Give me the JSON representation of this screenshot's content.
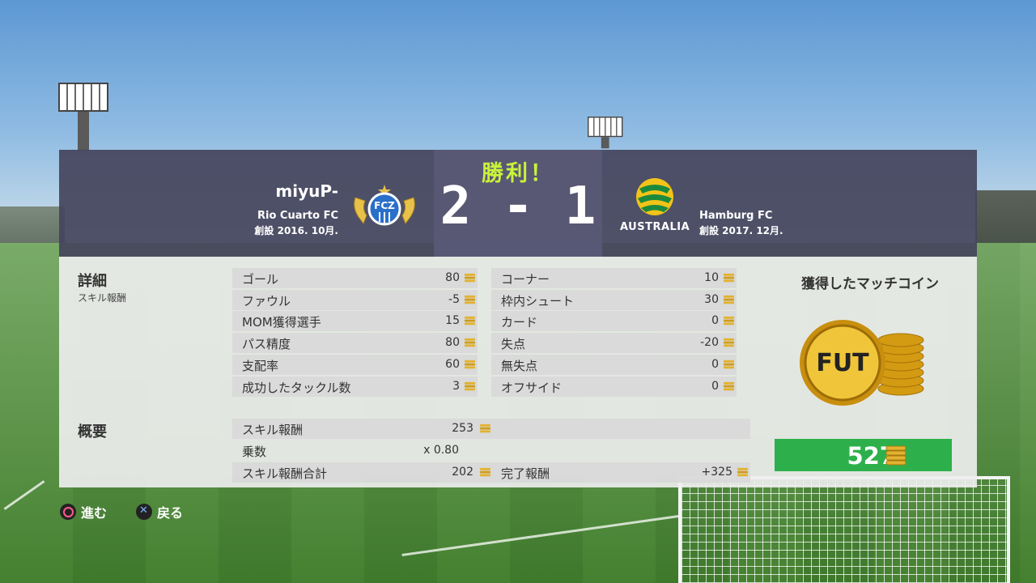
{
  "header": {
    "result": "勝利！",
    "score": "2 - 1",
    "home": {
      "player": "miyuP-",
      "club": "Rio Cuarto FC",
      "founded": "創設 2016. 10月.",
      "crest_text": "FCZ"
    },
    "away": {
      "club": "Hamburg FC",
      "founded": "創設 2017. 12月.",
      "crest_text": "AUSTRALIA"
    }
  },
  "details": {
    "title": "詳細",
    "subtitle": "スキル報酬",
    "left": [
      {
        "label": "ゴール",
        "value": "80"
      },
      {
        "label": "ファウル",
        "value": "-5"
      },
      {
        "label": "MOM獲得選手",
        "value": "15"
      },
      {
        "label": "パス精度",
        "value": "80"
      },
      {
        "label": "支配率",
        "value": "60"
      },
      {
        "label": "成功したタックル数",
        "value": "3"
      }
    ],
    "right": [
      {
        "label": "コーナー",
        "value": "10"
      },
      {
        "label": "枠内シュート",
        "value": "30"
      },
      {
        "label": "カード",
        "value": "0"
      },
      {
        "label": "失点",
        "value": "-20"
      },
      {
        "label": "無失点",
        "value": "0"
      },
      {
        "label": "オフサイド",
        "value": "0"
      }
    ]
  },
  "summary": {
    "title": "概要",
    "skill_reward": {
      "label": "スキル報酬",
      "value": "253"
    },
    "multiplier": {
      "label": "乗数",
      "value": "x 0.80"
    },
    "skill_total": {
      "label": "スキル報酬合計",
      "value": "202"
    },
    "completion": {
      "label": "完了報酬",
      "value": "+325"
    }
  },
  "coins": {
    "title": "獲得したマッチコイン",
    "logo_text": "FUT",
    "total": "527"
  },
  "footer": {
    "next_label": "進む",
    "back_label": "戻る"
  },
  "colors": {
    "result": "#c9f23a",
    "total_bg": "#2db04b",
    "coin_gold": "#d9a521"
  }
}
